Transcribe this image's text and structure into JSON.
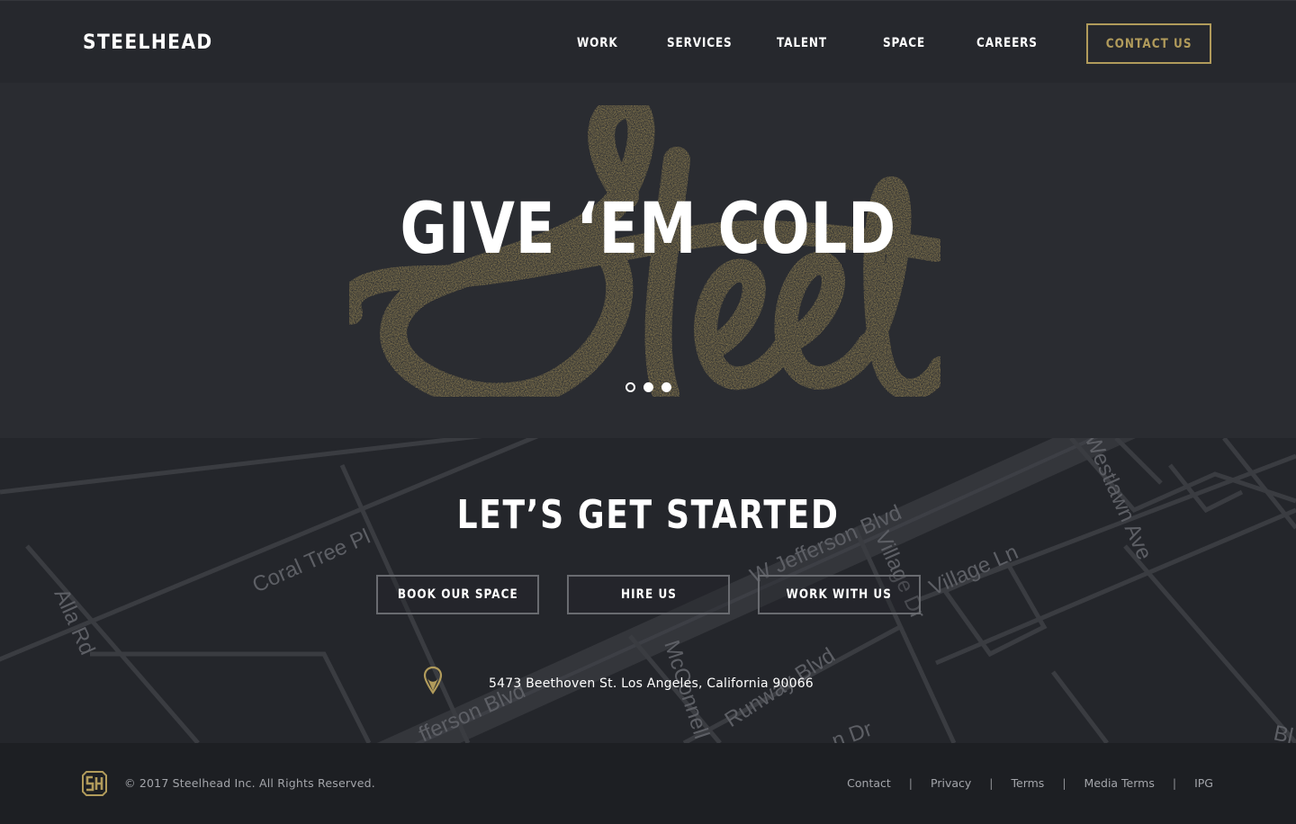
{
  "brand": {
    "logo_text": "STEELHEAD",
    "accent_color": "#b19b5b"
  },
  "nav": {
    "items": [
      {
        "label": "WORK"
      },
      {
        "label": "SERVICES"
      },
      {
        "label": "TALENT"
      },
      {
        "label": "SPACE"
      },
      {
        "label": "CAREERS"
      }
    ],
    "cta_label": "CONTACT US"
  },
  "hero": {
    "headline": "GIVE ‘EM COLD",
    "script_word": "Steel",
    "slides": {
      "count": 3,
      "active_index": 0
    }
  },
  "get_started": {
    "title": "LET’S GET STARTED",
    "buttons": [
      {
        "label": "BOOK OUR SPACE"
      },
      {
        "label": "HIRE US"
      },
      {
        "label": "WORK WITH US"
      }
    ],
    "address": "5473 Beethoven St. Los Angeles, California 90066",
    "address_icon": "map-pin-icon",
    "map_labels": {
      "coral_tree": "Coral Tree Pl",
      "alla": "Alla Rd",
      "jefferson_upper": "W Jefferson Blvd",
      "jefferson_lower": "fferson Blvd",
      "village_dr": "Village Dr",
      "village_ln": "Village Ln",
      "westlawn": "Westlawn Ave",
      "mcconnell": "McConnell",
      "runway": "Runway Blvd",
      "dr_stub": "n Dr",
      "bl_stub": "Bl"
    }
  },
  "footer": {
    "logo_icon": "sh-monogram-icon",
    "copyright": "©  2017 Steelhead Inc. All Rights Reserved.",
    "links": [
      {
        "label": "Contact"
      },
      {
        "label": "Privacy"
      },
      {
        "label": "Terms"
      },
      {
        "label": "Media Terms"
      },
      {
        "label": "IPG"
      }
    ],
    "separator": "|"
  }
}
